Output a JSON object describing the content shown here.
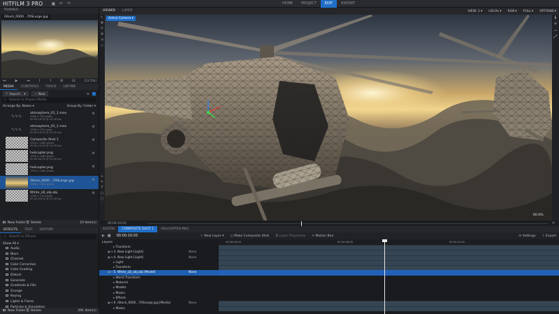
{
  "app": {
    "name": "HITFILM 3",
    "edition": "PRO"
  },
  "top_nav": [
    {
      "label": "HOME",
      "active": false
    },
    {
      "label": "PROJECT",
      "active": false
    },
    {
      "label": "EDIT",
      "active": true
    },
    {
      "label": "EXPORT",
      "active": false
    }
  ],
  "trimmer": {
    "title": "TRIMMER",
    "file_label": "iStock_0000...70SLarge.jpg",
    "zoom": "(12.5%)"
  },
  "media_panel": {
    "tabs": [
      {
        "label": "MEDIA",
        "active": true
      },
      {
        "label": "CONTROLS",
        "active": false
      },
      {
        "label": "TRACK",
        "active": false
      },
      {
        "label": "LIBTIME",
        "active": false
      }
    ],
    "import_label": "Import...",
    "new_label": "New",
    "search_placeholder": "Search in Project Media",
    "arrange_label": "Arrange By: Name",
    "group_label": "Group By: Folder",
    "items": [
      {
        "name": "atmosphere_01_1.mov",
        "line1": "1280 x 720 pixels",
        "line2": "00:00:18:20 @ 25.00 fps",
        "thumb": "none",
        "selected": false
      },
      {
        "name": "atmosphere_01_1.mov",
        "line1": "1280 x 720 pixels",
        "line2": "00:00:18:20 @ 25.00 fps",
        "thumb": "none",
        "selected": false
      },
      {
        "name": "Composite Shot 1",
        "line1": "1920 x 1080 pixels",
        "line2": "00:00:10:03 @ 25.00 fps",
        "thumb": "checker",
        "selected": false
      },
      {
        "name": "helicopter.png",
        "line1": "1920 x 1080 pixels",
        "line2": "00:00:04:00 @ 25.00 fps",
        "thumb": "checker",
        "selected": false
      },
      {
        "name": "helicopter.png",
        "line1": "1920 x 1080 pixels",
        "line2": "",
        "thumb": "checker",
        "selected": false
      },
      {
        "name": "iStock_0000...70SLarge.jpg",
        "line1": "2560 x 1440 pixels",
        "line2": "",
        "thumb": "sky",
        "selected": true
      },
      {
        "name": "White_LB_obj.obj",
        "line1": "1280 x 720 pixels",
        "line2": "00:00:04:00 @ 25.00 fps",
        "thumb": "checker",
        "selected": false
      }
    ],
    "footer_new_folder": "New Folder",
    "footer_delete": "Delete",
    "footer_count": "10 Item(s)"
  },
  "effects_panel": {
    "tabs": [
      {
        "label": "EFFECTS",
        "active": true
      },
      {
        "label": "TEXT",
        "active": false
      },
      {
        "label": "HISTORY",
        "active": false
      }
    ],
    "search_placeholder": "Search in Effects",
    "show_label": "Show All",
    "folders": [
      "Audio",
      "Blurs",
      "Channel",
      "Color Correction",
      "Color Grading",
      "Distort",
      "Generate",
      "Gradients & Fills",
      "Grunge",
      "Keying",
      "Lights & Flares",
      "Particles & Simulation"
    ],
    "footer_new_folder": "New Folder",
    "footer_delete": "Delete",
    "footer_count": "291 Item(s)"
  },
  "viewer": {
    "tabs": [
      {
        "label": "VIEWER",
        "active": true
      },
      {
        "label": "LAYER",
        "active": false
      }
    ],
    "options": [
      "VIEW: 1",
      "LOCAL",
      "RGB",
      "FULL",
      "OPTIONS"
    ],
    "active_camera": "Active Camera",
    "zoom": "60.0%",
    "timecode": "00:00:10:03"
  },
  "timeline": {
    "tabs": [
      {
        "label": "EDITOR",
        "active": false
      },
      {
        "label": "COMPOSITE SHOT 1",
        "active": true
      },
      {
        "label": "HELICOPTER.PNG",
        "active": false
      }
    ],
    "timecode": "00:00:10:03",
    "new_layer": "New Layer",
    "make_composite": "Make Composite Shot",
    "layer_properties": "Layer Properties",
    "motion_blur": "Motion Blur",
    "settings": "Settings",
    "export": "Export",
    "layers_label": "Layers",
    "ruler_marks": [
      "00:00:04:00",
      "00:00:08:00",
      "00:00:12:00"
    ],
    "rows": [
      {
        "name": "Transform",
        "indent": 2,
        "blend": "",
        "track": "bar",
        "selected": false
      },
      {
        "name": "3. New Light [Light]",
        "indent": 1,
        "blend": "None",
        "track": "bar",
        "selected": false
      },
      {
        "name": "4. New Light [Light]",
        "indent": 1,
        "blend": "None",
        "track": "bar",
        "selected": false
      },
      {
        "name": "Light",
        "indent": 2,
        "blend": "",
        "track": "bar",
        "selected": false
      },
      {
        "name": "Transform",
        "indent": 2,
        "blend": "",
        "track": "bar",
        "selected": false
      },
      {
        "name": "5. White_LB_obj.obj [Model]",
        "indent": 1,
        "blend": "None",
        "track": "barsel",
        "selected": true
      },
      {
        "name": "World Transform",
        "indent": 2,
        "blend": "",
        "track": "empty",
        "selected": false
      },
      {
        "name": "Material",
        "indent": 2,
        "blend": "",
        "track": "empty",
        "selected": false
      },
      {
        "name": "Models",
        "indent": 2,
        "blend": "",
        "track": "empty",
        "selected": false
      },
      {
        "name": "Masks",
        "indent": 2,
        "blend": "",
        "track": "empty",
        "selected": false
      },
      {
        "name": "Effects",
        "indent": 2,
        "blend": "",
        "track": "empty",
        "selected": false
      },
      {
        "name": "6. iStock_0000...70SLarge.jpg [Media]",
        "indent": 1,
        "blend": "None",
        "track": "bar",
        "selected": false
      },
      {
        "name": "Masks",
        "indent": 2,
        "blend": "",
        "track": "bar",
        "selected": false
      }
    ]
  },
  "colors": {
    "accent": "#1f6fc9",
    "selection": "#1f5596",
    "panel": "#1e1f23"
  }
}
